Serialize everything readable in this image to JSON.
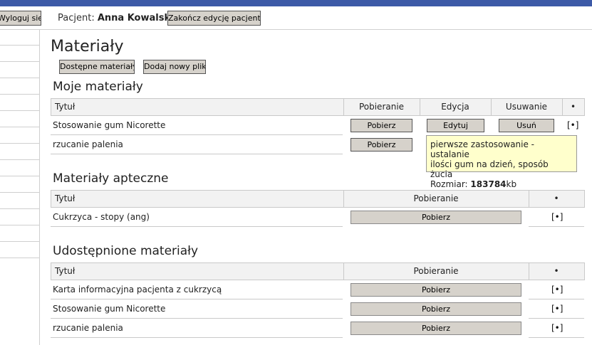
{
  "header": {
    "logout_label": "Wyloguj się",
    "patient_prefix": "Pacjent:",
    "patient_name": "Anna Kowalska",
    "end_edit_label": "Zakończ edycję pacjenta"
  },
  "page": {
    "title": "Materiały",
    "available_materials_label": "Dostępne materiały",
    "add_file_label": "Dodaj nowy plik"
  },
  "my_materials": {
    "title": "Moje materiały",
    "columns": [
      "Tytuł",
      "Pobieranie",
      "Edycja",
      "Usuwanie",
      "•"
    ],
    "rows": [
      {
        "title": "Stosowanie gum Nicorette",
        "download": "Pobierz",
        "edit": "Edytuj",
        "delete": "Usuń",
        "marker": "[•]"
      },
      {
        "title": "rzucanie palenia",
        "download": "Pobierz"
      }
    ]
  },
  "tooltip": {
    "line1": "pierwsze zastosowanie - ustalanie",
    "line2": "ilości gum na dzień, sposób żucia",
    "size_label": "Rozmiar:",
    "size_value": "183784",
    "size_unit": "kb"
  },
  "pharmacy_materials": {
    "title": "Materiały apteczne",
    "columns": [
      "Tytuł",
      "Pobieranie",
      "•"
    ],
    "rows": [
      {
        "title": "Cukrzyca - stopy (ang)",
        "download": "Pobierz",
        "marker": "[•]"
      }
    ]
  },
  "shared_materials": {
    "title": "Udostępnione materiały",
    "columns": [
      "Tytuł",
      "Pobieranie",
      "•"
    ],
    "rows": [
      {
        "title": "Karta informacyjna pacjenta z cukrzycą",
        "download": "Pobierz",
        "marker": "[•]"
      },
      {
        "title": "Stosowanie gum Nicorette",
        "download": "Pobierz",
        "marker": "[•]"
      },
      {
        "title": "rzucanie palenia",
        "download": "Pobierz",
        "marker": "[•]"
      }
    ]
  }
}
